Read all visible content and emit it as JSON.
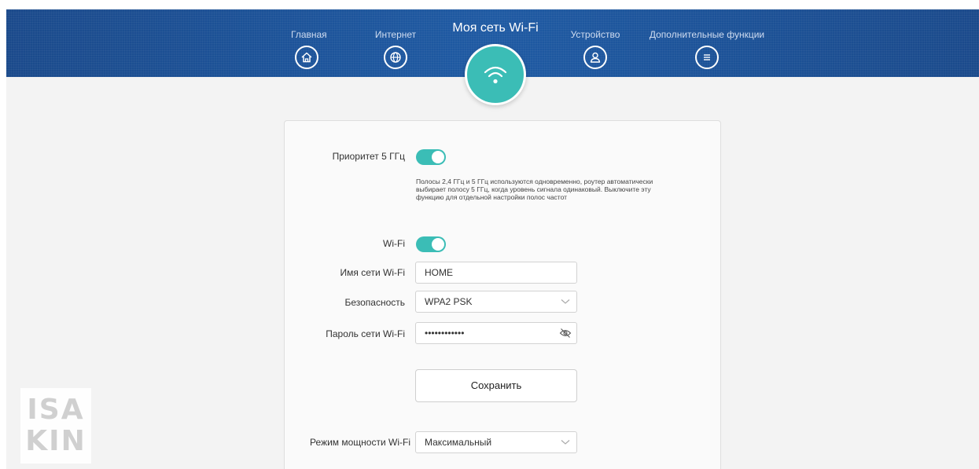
{
  "nav": {
    "items": [
      {
        "label": "Главная",
        "icon": "home-icon"
      },
      {
        "label": "Интернет",
        "icon": "globe-icon"
      },
      {
        "label": "Устройство",
        "icon": "user-icon"
      },
      {
        "label": "Дополнительные функции",
        "icon": "menu-icon"
      }
    ],
    "active_label": "Моя сеть Wi-Fi",
    "active_icon": "wifi-icon"
  },
  "settings": {
    "priority_5ghz": {
      "label": "Приоритет 5 ГГц",
      "enabled": true,
      "description": "Полосы 2,4 ГГц и 5 ГГц используются одновременно, роутер автоматически выбирает полосу 5 ГГц, когда уровень сигнала одинаковый. Выключите эту функцию для отдельной настройки полос частот"
    },
    "wifi": {
      "label": "Wi-Fi",
      "enabled": true
    },
    "ssid": {
      "label": "Имя сети Wi-Fi",
      "value": "HOME"
    },
    "security": {
      "label": "Безопасность",
      "value": "WPA2 PSK"
    },
    "password": {
      "label": "Пароль сети Wi-Fi",
      "value": "••••••••••••"
    },
    "save_label": "Сохранить",
    "power_mode": {
      "label": "Режим мощности Wi-Fi",
      "value": "Максимальный"
    }
  },
  "watermark": {
    "lines": [
      "ISA",
      "KIN"
    ]
  },
  "colors": {
    "header": "#1d559c",
    "accent": "#3bbdb6",
    "background": "#f3f3f3"
  }
}
